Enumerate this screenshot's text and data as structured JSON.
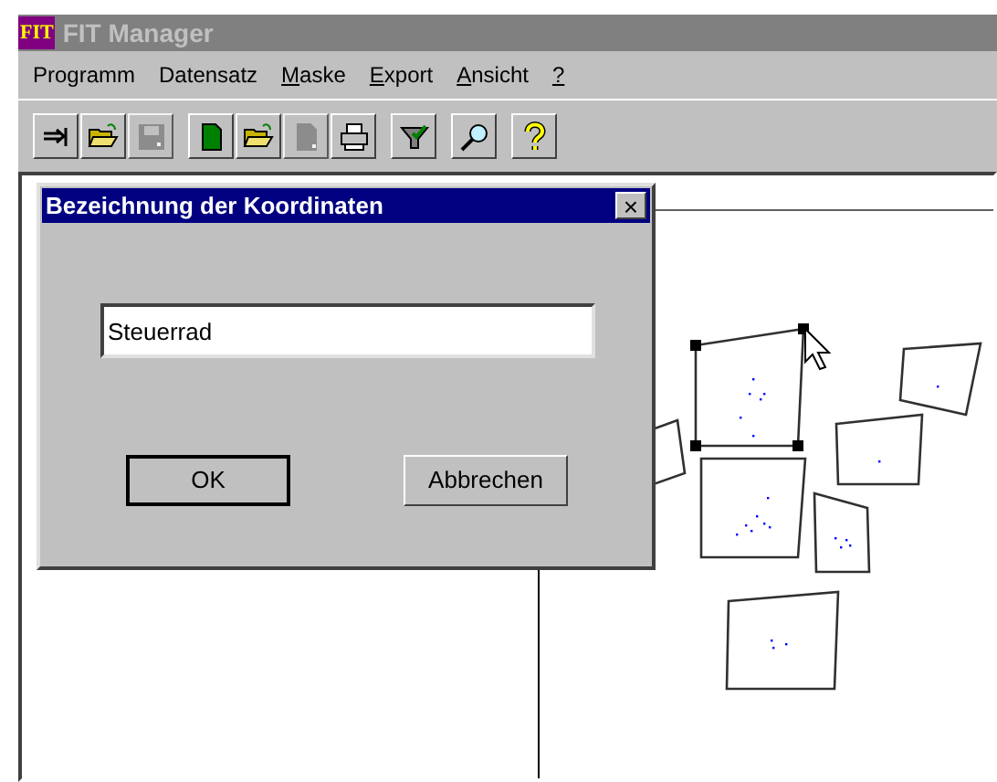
{
  "window": {
    "logo": "FIT",
    "title": "FIT Manager",
    "active": false
  },
  "menu": [
    {
      "label": "Programm",
      "mnemonic": false
    },
    {
      "label": "Datensatz",
      "mnemonic": false
    },
    {
      "label": "Maske",
      "mnemonic": true
    },
    {
      "label": "Export",
      "mnemonic": true
    },
    {
      "label": "Ansicht",
      "mnemonic": true
    },
    {
      "label": "?",
      "mnemonic": true
    }
  ],
  "toolbar": [
    [
      {
        "disabled": false
      },
      {
        "disabled": false
      },
      {
        "disabled": true
      }
    ],
    [
      {
        "disabled": false
      },
      {
        "disabled": false
      },
      {
        "disabled": true
      },
      {
        "disabled": false
      }
    ],
    [
      {
        "disabled": false
      }
    ],
    [
      {
        "disabled": false
      }
    ],
    [
      {
        "disabled": false
      }
    ]
  ],
  "dialog": {
    "title": "Bezeichnung der Koordinaten",
    "active": true,
    "close": "×",
    "value": "Steuerrad",
    "buttons": [
      {
        "label": "OK",
        "default": true
      },
      {
        "label": "Abbrechen",
        "default": false
      }
    ]
  }
}
